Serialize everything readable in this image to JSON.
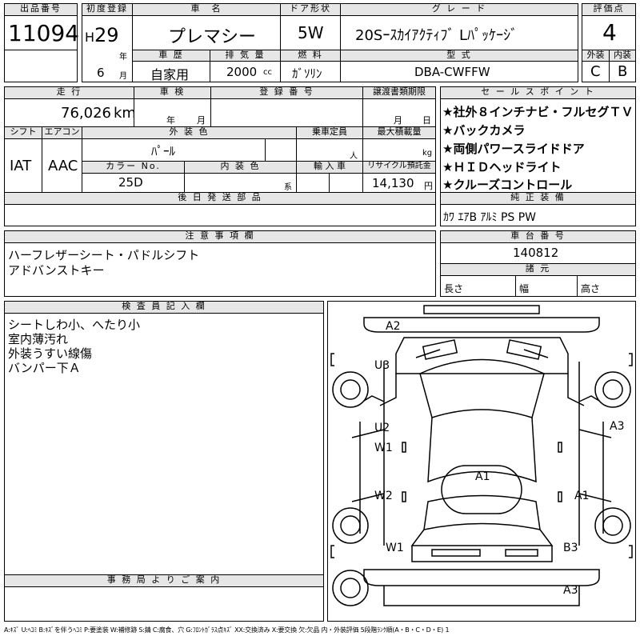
{
  "header": {
    "lot_label": "出品番号",
    "lot_value": "11094",
    "first_reg_label": "初度登録",
    "era": "H",
    "year": "29",
    "year_unit": "年",
    "month": "6",
    "month_unit": "月",
    "car_name_label": "車　名",
    "car_name": "プレマシー",
    "door_label": "ドア形状",
    "door": "5W",
    "grade_label": "グ レ ー ド",
    "grade": "20Sｰｽｶｲｱｸﾃｨﾌﾞ Lﾊﾟｯｹｰｼﾞ",
    "score_label": "評価点",
    "score": "4",
    "history_label": "車 歴",
    "history": "自家用",
    "displacement_label": "排 気 量",
    "displacement": "2000",
    "displacement_unit": "cc",
    "fuel_label": "燃 料",
    "fuel": "ｶﾞｿﾘﾝ",
    "model_label": "型 式",
    "model": "DBA-CWFFW",
    "exterior_label": "外装",
    "exterior": "C",
    "interior_label": "内装",
    "interior": "B"
  },
  "row2": {
    "mileage_label": "走 行",
    "mileage": "76,026",
    "mileage_unit": "km",
    "inspection_label": "車 検",
    "insp_year_unit": "年",
    "insp_month_unit": "月",
    "reg_no_label": "登 録 番 号",
    "docs_label": "譲渡書類期限",
    "docs_month_unit": "月",
    "docs_day_unit": "日",
    "sales_label": "セ ー ル ス ポ イ ン ト",
    "sales_points": [
      "★社外８インチナビ・フルセグＴＶ",
      "★バックカメラ",
      "★両側パワースライドドア",
      "★ＨＩＤヘッドライト",
      "★クルーズコントロール"
    ],
    "shift_label": "シフト",
    "shift": "IAT",
    "ac_label": "エアコン",
    "ac": "AAC",
    "ext_color_label": "外 装 色",
    "ext_color": "ﾊﾟｰﾙ",
    "capacity_label": "乗車定員",
    "capacity_unit": "人",
    "max_load_label": "最大積載量",
    "max_load_unit": "kg",
    "color_no_label": "カラー No.",
    "color_no": "25D",
    "int_color_label": "内 装 色",
    "int_color_unit": "系",
    "import_label": "輸 入 車",
    "recycle_label": "リサイクル預託金",
    "recycle": "14,130",
    "recycle_unit": "円"
  },
  "later_parts": {
    "label": "後 日 発 送 部 品"
  },
  "genuine": {
    "label": "純 正 装 備",
    "value": "ｶﾜ ｴｱB ｱﾙﾐ PS PW"
  },
  "notes": {
    "label": "注 意 事 項 欄",
    "lines": [
      "ハーフレザーシート・パドルシフト",
      "アドバンストキー"
    ]
  },
  "chassis": {
    "label": "車 台 番 号",
    "value": "140812",
    "dims_label": "諸 元",
    "length_label": "長さ",
    "width_label": "幅",
    "height_label": "高さ"
  },
  "inspector": {
    "label": "検 査 員 記 入 欄",
    "lines": [
      "シートしわ小、へたり小",
      "室内薄汚れ",
      "外装うすい線傷",
      "バンパー下Ａ"
    ]
  },
  "office": {
    "label": "事 務 局 よ り ご 案 内"
  },
  "diagram": {
    "marks": [
      "A2",
      "U3",
      "U2",
      "W1",
      "W2",
      "A1",
      "W1",
      "A3",
      "A1",
      "B3",
      "A3"
    ]
  },
  "footer": {
    "legend": "A:ｷｽﾞ U:ﾍｺﾐ B:ｷｽﾞを伴うﾍｺﾐ P:要塗装 W:補修跡 S:錆 C:腐食、穴 G:ﾌﾛﾝﾄｶﾞﾗｽ点ｷｽﾞ XX:交換済み X:要交換 欠:欠品 内・外装評価 5段階ﾗﾝｸ順(A・B・C・D・E) 1"
  }
}
